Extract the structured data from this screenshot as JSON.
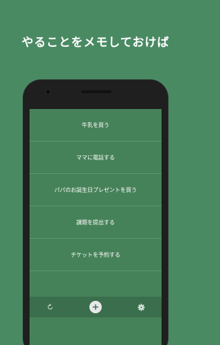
{
  "headline": "やることをメモしておけば",
  "tasks": [
    {
      "label": "牛乳を買う"
    },
    {
      "label": "ママに電話する"
    },
    {
      "label": "パパのお誕生日プレゼントを買う"
    },
    {
      "label": "課題を提出する"
    },
    {
      "label": "チケットを予約する"
    }
  ],
  "toolbar": {
    "refresh_icon": "refresh-icon",
    "add_icon": "plus-icon",
    "settings_icon": "gear-icon"
  },
  "colors": {
    "background": "#4a8a63",
    "screen": "#468259",
    "toolbar": "#3a6e4c",
    "phone_body": "#1f1f1f"
  }
}
